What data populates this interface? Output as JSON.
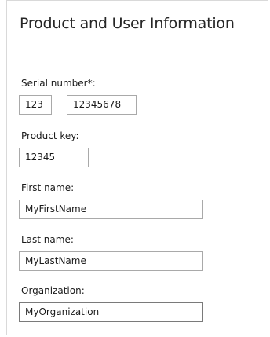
{
  "page": {
    "title": "Product and User Information"
  },
  "serial": {
    "label": "Serial number*:",
    "part1": "123",
    "separator": "-",
    "part2": "12345678"
  },
  "product_key": {
    "label": "Product key:",
    "value": "12345"
  },
  "first_name": {
    "label": "First name:",
    "value": "MyFirstName"
  },
  "last_name": {
    "label": "Last name:",
    "value": "MyLastName"
  },
  "organization": {
    "label": "Organization:",
    "value": "MyOrganization"
  }
}
